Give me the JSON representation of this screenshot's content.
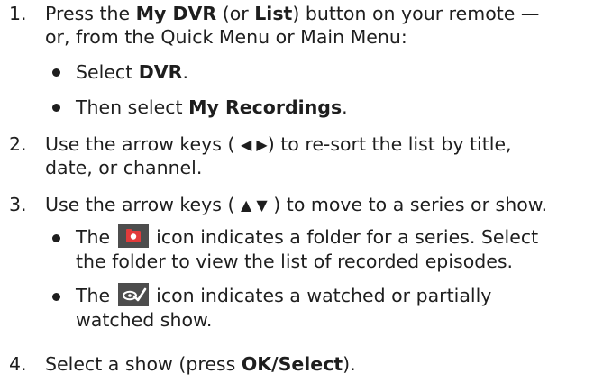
{
  "steps": [
    {
      "number": "1.",
      "line1_pre": "Press the ",
      "line1_b1": "My DVR",
      "line1_mid": " (or ",
      "line1_b2": "List",
      "line1_post": ") button on your remote —",
      "line2": "or, from the Quick Menu or Main Menu:",
      "bullets": [
        {
          "pre": "Select ",
          "bold": "DVR",
          "post": "."
        },
        {
          "pre": "Then select ",
          "bold": "My Recordings",
          "post": "."
        }
      ]
    },
    {
      "number": "2.",
      "line1_pre": "Use the arrow keys (",
      "arrows": "◀ ▶",
      "line1_post": ") to re-sort the list by title,",
      "line2": "date, or channel."
    },
    {
      "number": "3.",
      "line1_pre": "Use the arrow keys (",
      "arrows": "▲ ▼",
      "line1_post": ") to move to a series or show.",
      "bullets": [
        {
          "pre": "The ",
          "icon": "folder-record-icon",
          "post": " icon indicates a folder for a series. Select",
          "line2": "the folder to view the list of recorded episodes."
        },
        {
          "pre": "The ",
          "icon": "watched-check-icon",
          "post": " icon indicates a watched or partially",
          "line2": "watched show."
        }
      ]
    },
    {
      "number": "4.",
      "line1_pre": "Select a show (press ",
      "line1_b1": "OK/Select",
      "line1_post": ")."
    }
  ],
  "colors": {
    "text": "#1e1e1e",
    "icon_background": "#4d4d4d",
    "folder_icon": "#e23b3b",
    "watched_icon": "#ffffff"
  }
}
